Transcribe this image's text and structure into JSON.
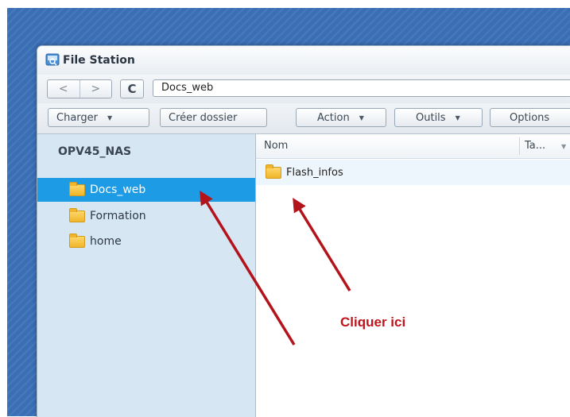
{
  "window": {
    "title": "File Station",
    "icon": "file-station-icon"
  },
  "nav": {
    "back_glyph": "<",
    "forward_glyph": ">",
    "refresh_glyph": "C",
    "path": "Docs_web"
  },
  "toolbar": {
    "upload_label": "Charger",
    "create_folder_label": "Créer dossier",
    "action_label": "Action",
    "tools_label": "Outils",
    "options_label": "Options"
  },
  "sidebar": {
    "nas_name": "OPV45_NAS",
    "items": [
      {
        "label": "Docs_web",
        "selected": true
      },
      {
        "label": "Formation",
        "selected": false
      },
      {
        "label": "home",
        "selected": false
      }
    ]
  },
  "filelist": {
    "columns": {
      "name": "Nom",
      "size": "Ta..."
    },
    "rows": [
      {
        "name": "Flash_infos"
      }
    ]
  },
  "annotation": {
    "text": "Cliquer ici",
    "color": "#c0141c"
  },
  "colors": {
    "selection": "#1e9be5",
    "sidebar": "#d6e6f3",
    "desktop": "#3a6fb6"
  }
}
